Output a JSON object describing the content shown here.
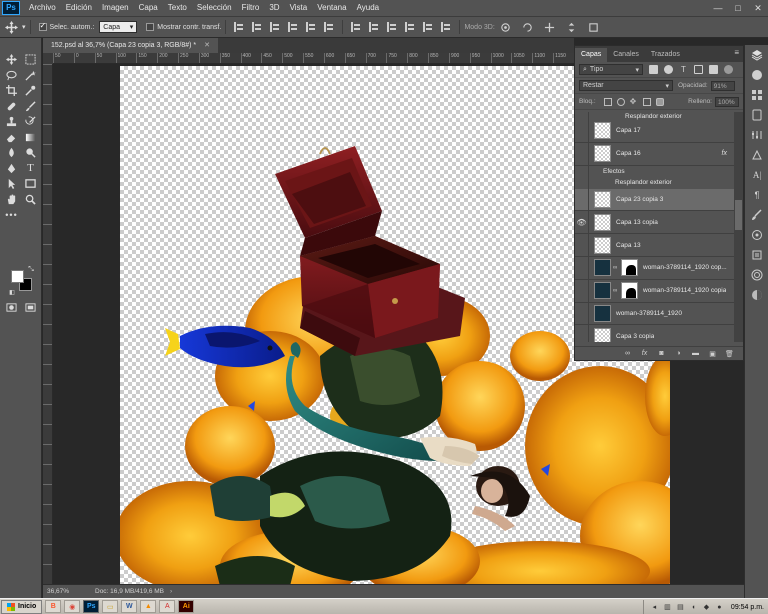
{
  "app": {
    "logo_text": "Ps"
  },
  "menu": {
    "items": [
      "Archivo",
      "Edición",
      "Imagen",
      "Capa",
      "Texto",
      "Selección",
      "Filtro",
      "3D",
      "Vista",
      "Ventana",
      "Ayuda"
    ]
  },
  "window_controls": {
    "minimize": "—",
    "maximize": "□",
    "close": "✕"
  },
  "options_bar": {
    "auto_select_label": "Selec. autom.:",
    "auto_select_checked": true,
    "auto_select_value": "Capa",
    "show_transform_label": "Mostrar contr. transf.",
    "show_transform_checked": false,
    "mode_3d_label": "Modo 3D:"
  },
  "document": {
    "tab_title": "152.psd al 36,7% (Capa 23 copia 3, RGB/8#) *",
    "ruler_top_ticks": [
      "50",
      "0",
      "50",
      "100",
      "150",
      "200",
      "250",
      "300",
      "350",
      "400",
      "450",
      "500",
      "550",
      "600",
      "650",
      "700",
      "750",
      "800",
      "850",
      "900",
      "950",
      "1000",
      "1050",
      "1100",
      "1150"
    ]
  },
  "layers_panel": {
    "tabs": [
      "Capas",
      "Canales",
      "Trazados"
    ],
    "active_tab": "Capas",
    "filter_kind": "Tipo",
    "blend_mode": "Restar",
    "opacity_label": "Opacidad:",
    "opacity_value": "91%",
    "lock_label": "Bloq.:",
    "fill_label": "Relleno:",
    "fill_value": "100%",
    "partial_top_label": "Resplandor exterior",
    "layers": [
      {
        "name": "Capa 17",
        "visible": false,
        "thumb": "checker"
      },
      {
        "name": "Capa 16",
        "visible": false,
        "thumb": "checker",
        "fx": "fx"
      },
      {
        "name": "Efectos",
        "sub": true,
        "visible": true
      },
      {
        "name": "Resplandor exterior",
        "sub": true,
        "visible": false
      },
      {
        "name": "Capa 23 copia 3",
        "visible": false,
        "thumb": "checker",
        "selected": true
      },
      {
        "name": "Capa 13 copia",
        "visible": true,
        "thumb": "checker"
      },
      {
        "name": "Capa 13",
        "visible": false,
        "thumb": "checker"
      },
      {
        "name": "woman-3789114_1920 cop...",
        "visible": false,
        "thumb": "dark",
        "mask": true
      },
      {
        "name": "woman-3789114_1920 copia",
        "visible": false,
        "thumb": "dark",
        "mask": true
      },
      {
        "name": "woman-3789114_1920",
        "visible": false,
        "thumb": "dark"
      },
      {
        "name": "Capa 3 copia",
        "visible": false,
        "thumb": "checker"
      }
    ],
    "footer_icons": [
      "link-icon",
      "fx-icon",
      "mask-icon",
      "adjustment-icon",
      "folder-icon",
      "new-layer-icon",
      "trash-icon"
    ]
  },
  "status_bar": {
    "zoom": "36,67%",
    "doc_info": "Doc: 16,9 MB/419,6 MB"
  },
  "taskbar": {
    "start_label": "Inicio",
    "clock": "09:54 p.m.",
    "apps": [
      "brave",
      "chrome",
      "photoshop",
      "explorer",
      "word",
      "vlc",
      "acrobat",
      "illustrator"
    ]
  },
  "colors": {
    "ui_bg": "#535353",
    "foreground_swatch": "#ffffff",
    "background_swatch": "#000000",
    "ps_blue": "#31a8ff"
  }
}
